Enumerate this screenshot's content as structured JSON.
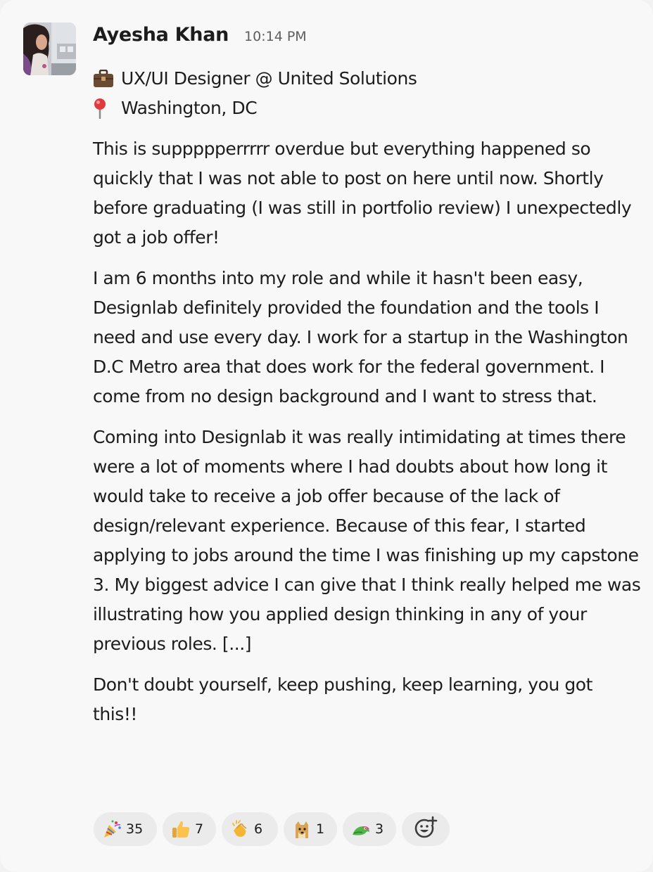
{
  "message": {
    "author": "Ayesha Khan",
    "time": "10:14 PM",
    "profile": {
      "role_icon": "briefcase-icon",
      "role": "UX/UI Designer @ United Solutions",
      "location_icon": "round-pushpin-icon",
      "location": "Washington, DC"
    },
    "paragraphs": [
      "This is suppppperrrrr overdue but everything happened so quickly that I was not able to post on here until now. Shortly before graduating (I was still in portfolio review) I unexpectedly got a job offer!",
      "I am 6 months into my role and while it hasn't been easy, Designlab definitely provided the foundation and the tools I need and use every day. I work for a startup in the Washington D.C Metro area that does work for the federal government. I come from no design background and I want to stress that.",
      "Coming into Designlab it was really intimidating at times there were a lot of moments where I had doubts about how long it would take to receive a job offer because of the lack of design/relevant experience. Because of this fear, I started applying to jobs around the time I was finishing up my capstone 3. My biggest advice I can give that I think really helped me was illustrating how you applied design thinking in any of your previous roles. [...]",
      "Don't doubt yourself, keep pushing, keep learning, you got this!!"
    ]
  },
  "reactions": [
    {
      "icon": "party-popper-icon",
      "count": "35"
    },
    {
      "icon": "thumbs-up-icon",
      "count": "7"
    },
    {
      "icon": "clapping-hands-icon",
      "count": "6"
    },
    {
      "icon": "doge-icon",
      "count": "1"
    },
    {
      "icon": "party-parrot-icon",
      "count": "3"
    }
  ],
  "add_reaction_icon": "add-reaction-icon",
  "colors": {
    "text": "#1d1c1d",
    "muted": "#5e5d60",
    "pill_bg": "#ebebeb",
    "card_bg": "#f8f8f8"
  }
}
